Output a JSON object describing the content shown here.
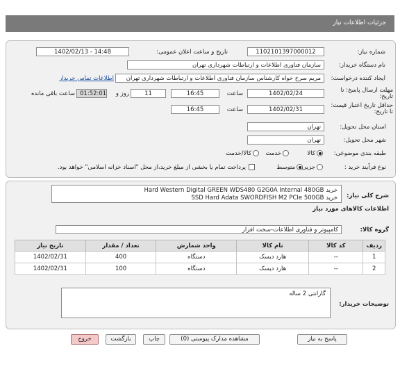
{
  "header": {
    "title": "جزئیات اطلاعات نیاز"
  },
  "need": {
    "need_number_label": "شماره نیاز:",
    "need_number": "1102101397000012",
    "announce_label": "تاریخ و ساعت اعلان عمومی:",
    "announce_value": "1402/02/13 - 14:48",
    "buyer_org_label": "نام دستگاه خریدار:",
    "buyer_org": "سازمان فناوری اطلاعات و ارتباطات شهرداری تهران",
    "creator_label": "ایجاد کننده درخواست:",
    "creator": "مریم سرخ خواه کارشناس سازمان فناوری اطلاعات و ارتباطات شهرداری تهران",
    "contact_link": "اطلاعات تماس خریدار",
    "deadline_label": "مهلت ارسال پاسخ: تا تاریخ:",
    "deadline_date": "1402/02/24",
    "time_label": "ساعت",
    "deadline_time": "16:45",
    "days_value": "11",
    "days_label": "روز و",
    "remaining_time": "01:52:01",
    "remaining_label": "ساعت باقی مانده",
    "validity_label": "حداقل تاریخ اعتبار قیمت: تا تاریخ:",
    "validity_date": "1402/02/31",
    "validity_time": "16:45",
    "province_label": "استان محل تحویل:",
    "province": "تهران",
    "city_label": "شهر محل تحویل:",
    "city": "تهران",
    "category_label": "طبقه بندی موضوعی:",
    "category_options": [
      "کالا",
      "خدمت",
      "کالا/خدمت"
    ],
    "process_label": "نوع فرآیند خرید :",
    "process_options": [
      "جزیی",
      "متوسط"
    ],
    "payment_note": "پرداخت تمام یا بخشی از مبلغ خرید،از محل \"اسناد خزانه اسلامی\" خواهد بود."
  },
  "description": {
    "label": "شرح کلی نیاز:",
    "lines": [
      "خرید Hard Western Digital GREEN WDS480 G2G0A Internal 480GB",
      "خرید SSD Hard Adata SWORDFISH M2 PCIe 500GB"
    ]
  },
  "goods": {
    "section_title": "اطلاعات کالاهای مورد نیاز",
    "group_label": "گروه کالا:",
    "group_value": "کامپیوتر و فناوری اطلاعات-سخت افزار",
    "columns": [
      "ردیف",
      "کد کالا",
      "نام کالا",
      "واحد شمارش",
      "تعداد / مقدار",
      "تاریخ نیاز"
    ],
    "rows": [
      {
        "row": "1",
        "code": "--",
        "name": "هارد دیسک",
        "unit": "دستگاه",
        "qty": "400",
        "date": "1402/02/31"
      },
      {
        "row": "2",
        "code": "--",
        "name": "هارد دیسک",
        "unit": "دستگاه",
        "qty": "100",
        "date": "1402/02/31"
      }
    ]
  },
  "buyer_notes": {
    "label": "توضیحات خریدار:",
    "text": "گارانتی 2 ساله"
  },
  "buttons": {
    "respond": "پاسخ به نیاز",
    "view_docs": "مشاهده مدارک پیوستی (0)",
    "print": "چاپ",
    "back": "بازگشت",
    "exit": "خروج"
  }
}
